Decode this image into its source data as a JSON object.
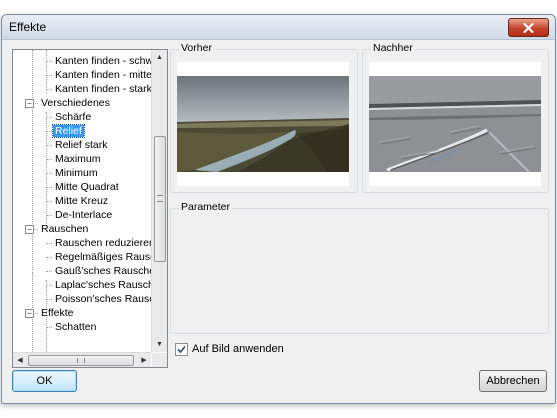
{
  "window": {
    "title": "Effekte"
  },
  "tree": {
    "items": [
      {
        "label": "Kanten finden - schwach",
        "level": 1,
        "selected": false
      },
      {
        "label": "Kanten finden - mittel",
        "level": 1,
        "selected": false
      },
      {
        "label": "Kanten finden - stark",
        "level": 1,
        "selected": false
      },
      {
        "label": "Verschiedenes",
        "level": 0,
        "expanded": true
      },
      {
        "label": "Schärfe",
        "level": 1,
        "selected": false
      },
      {
        "label": "Relief",
        "level": 1,
        "selected": true
      },
      {
        "label": "Relief stark",
        "level": 1,
        "selected": false
      },
      {
        "label": "Maximum",
        "level": 1,
        "selected": false
      },
      {
        "label": "Minimum",
        "level": 1,
        "selected": false
      },
      {
        "label": "Mitte Quadrat",
        "level": 1,
        "selected": false
      },
      {
        "label": "Mitte Kreuz",
        "level": 1,
        "selected": false
      },
      {
        "label": "De-Interlace",
        "level": 1,
        "selected": false
      },
      {
        "label": "Rauschen",
        "level": 0,
        "expanded": true
      },
      {
        "label": "Rauschen reduzieren",
        "level": 1,
        "selected": false
      },
      {
        "label": "Regelmäßiges Rauschen",
        "level": 1,
        "selected": false
      },
      {
        "label": "Gauß'sches Rauschen hinzufügen",
        "level": 1,
        "selected": false
      },
      {
        "label": "Laplac'sches Rauschen",
        "level": 1,
        "selected": false
      },
      {
        "label": "Poisson'sches Rauschen",
        "level": 1,
        "selected": false
      },
      {
        "label": "Effekte",
        "level": 0,
        "expanded": true
      },
      {
        "label": "Schatten",
        "level": 1,
        "selected": false
      }
    ],
    "toggle_symbol": "−"
  },
  "preview": {
    "before_label": "Vorher",
    "after_label": "Nachher"
  },
  "parameters": {
    "label": "Parameter"
  },
  "apply": {
    "label": "Auf Bild anwenden",
    "checked": true
  },
  "buttons": {
    "ok": "OK",
    "cancel": "Abbrechen"
  },
  "colors": {
    "selection": "#3399ff",
    "window_bg": "#f0f0f0",
    "close_button": "#c5432c"
  }
}
